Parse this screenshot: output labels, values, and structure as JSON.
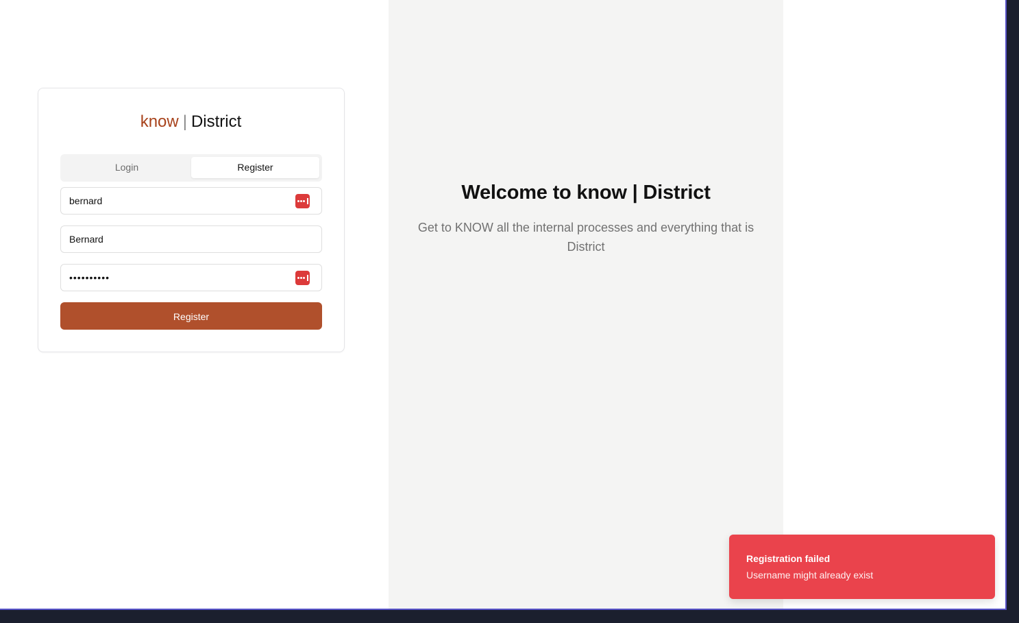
{
  "brand": {
    "part1": "know",
    "separator": "|",
    "part2": "District",
    "accent_color": "#a8431c"
  },
  "auth": {
    "tabs": [
      {
        "label": "Login",
        "active": false
      },
      {
        "label": "Register",
        "active": true
      }
    ],
    "fields": {
      "username": {
        "value": "bernard",
        "has_password_manager_icon": true
      },
      "display_name": {
        "value": "Bernard"
      },
      "password": {
        "value": "••••••••••",
        "has_password_manager_icon": true
      }
    },
    "submit_label": "Register",
    "submit_color": "#b0502c"
  },
  "welcome": {
    "title": "Welcome to know | District",
    "subtitle": "Get to KNOW all the internal processes and everything that is District"
  },
  "toast": {
    "title": "Registration failed",
    "description": "Username might already exist",
    "color": "#ea434c"
  },
  "icons": {
    "password_manager": "password-manager-icon"
  }
}
